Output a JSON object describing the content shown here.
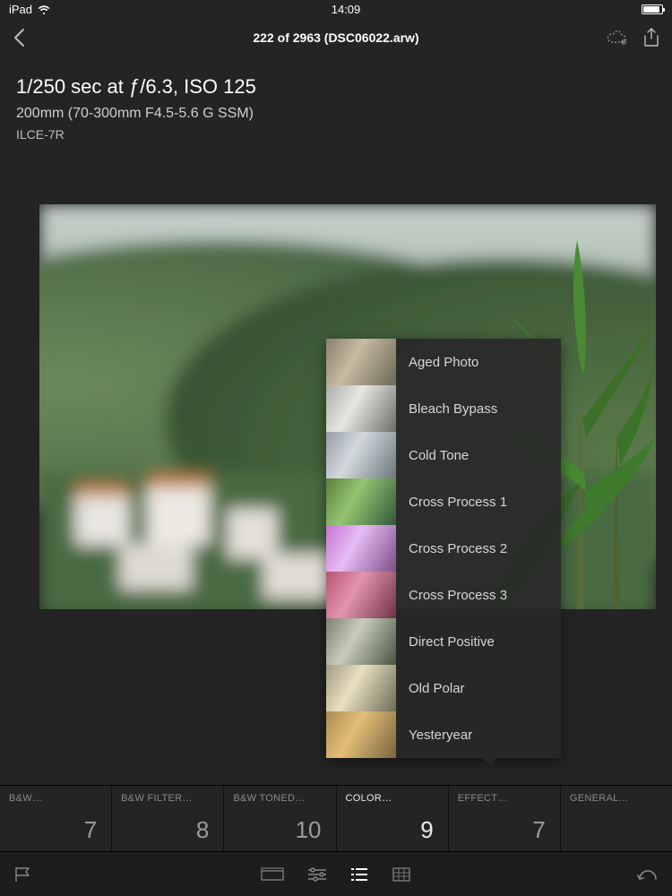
{
  "status": {
    "device": "iPad",
    "time": "14:09"
  },
  "nav": {
    "title": "222 of 2963 (DSC06022.arw)"
  },
  "metadata": {
    "exposure": "1/250 sec at ƒ/6.3, ISO 125",
    "lens": "200mm (70-300mm F4.5-5.6 G SSM)",
    "camera": "ILCE-7R"
  },
  "presets": [
    {
      "label": "Aged Photo",
      "thumb_class": "th-aged"
    },
    {
      "label": "Bleach Bypass",
      "thumb_class": "th-bleach"
    },
    {
      "label": "Cold Tone",
      "thumb_class": "th-cold"
    },
    {
      "label": "Cross Process 1",
      "thumb_class": "th-cp1"
    },
    {
      "label": "Cross Process 2",
      "thumb_class": "th-cp2"
    },
    {
      "label": "Cross Process 3",
      "thumb_class": "th-cp3"
    },
    {
      "label": "Direct Positive",
      "thumb_class": "th-direct"
    },
    {
      "label": "Old Polar",
      "thumb_class": "th-polar"
    },
    {
      "label": "Yesteryear",
      "thumb_class": "th-yester"
    }
  ],
  "categories": [
    {
      "label": "B&W…",
      "count": "7",
      "selected": false
    },
    {
      "label": "B&W FILTER…",
      "count": "8",
      "selected": false
    },
    {
      "label": "B&W TONED…",
      "count": "10",
      "selected": false
    },
    {
      "label": "COLOR…",
      "count": "9",
      "selected": true
    },
    {
      "label": "EFFECT…",
      "count": "7",
      "selected": false
    },
    {
      "label": "GENERAL…",
      "count": "",
      "selected": false
    }
  ]
}
